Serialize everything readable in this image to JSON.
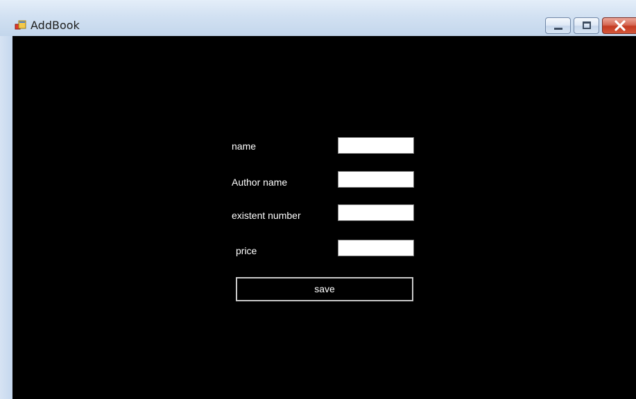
{
  "window": {
    "title": "AddBook",
    "icon": "winforms-app-icon"
  },
  "caption_buttons": {
    "minimize_icon": "minimize-icon",
    "maximize_icon": "maximize-icon",
    "close_icon": "close-icon"
  },
  "form": {
    "fields": [
      {
        "label": "name",
        "value": ""
      },
      {
        "label": "Author name",
        "value": ""
      },
      {
        "label": "existent number",
        "value": ""
      },
      {
        "label": "price",
        "value": ""
      }
    ],
    "save_label": "save"
  },
  "colors": {
    "client_background": "#000000",
    "label_text": "#ffffff",
    "input_background": "#ffffff",
    "save_border": "#c9c9c9"
  }
}
